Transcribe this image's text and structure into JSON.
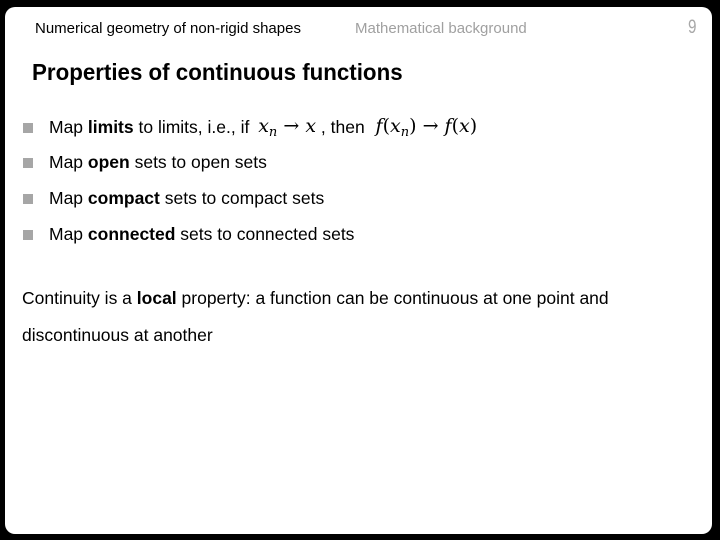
{
  "header": {
    "course": "Numerical geometry of non-rigid shapes",
    "section": "Mathematical background",
    "page_number": "9"
  },
  "title": "Properties of continuous functions",
  "bullets": [
    {
      "prefix": "Map ",
      "bold": "limits",
      "suffix": " to limits, i.e., if ",
      "math1": {
        "var": "x",
        "sub": "n",
        "arrow": "→",
        "target": "x"
      },
      "middle": " , then ",
      "math2": {
        "f": "f",
        "lp": "(",
        "var": "x",
        "sub": "n",
        "rp": ")",
        "arrow": "→",
        "target": "f",
        "tlp": "(",
        "tvar": "x",
        "trp": ")"
      }
    },
    {
      "prefix": "Map ",
      "bold": "open",
      "suffix": " sets to open sets"
    },
    {
      "prefix": "Map ",
      "bold": "compact",
      "suffix": " sets to compact sets"
    },
    {
      "prefix": "Map ",
      "bold": "connected",
      "suffix": " sets to connected sets"
    }
  ],
  "paragraph": {
    "prefix": "Continuity is a ",
    "bold": "local",
    "suffix": " property: a function can be continuous at one point and discontinuous at another"
  },
  "colors": {
    "bullet": "#a6a6a6",
    "section_text": "#a0a0a0",
    "frame": "#000000",
    "slide_bg": "#ffffff"
  }
}
